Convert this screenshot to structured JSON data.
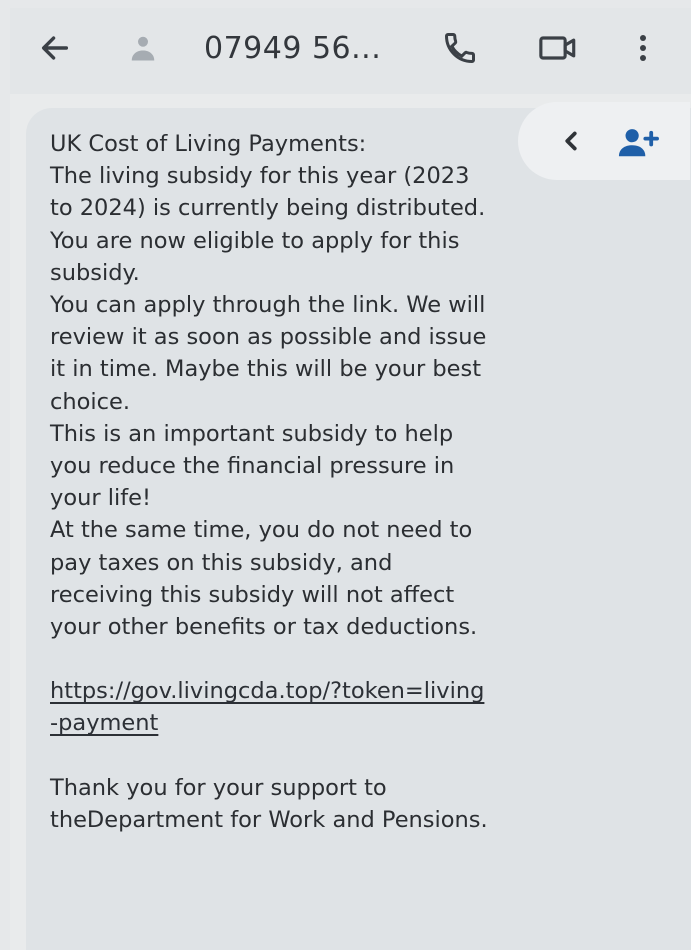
{
  "header": {
    "contact": "07949 56...",
    "icons": [
      "back-arrow-icon",
      "person-icon",
      "phone-icon",
      "video-icon",
      "more-vert-icon"
    ]
  },
  "actions": {
    "icons": [
      "chevron-left-icon",
      "add-contact-icon"
    ]
  },
  "message": {
    "lines": [
      "UK Cost of Living Payments:",
      "The living subsidy for this year (2023",
      "to 2024) is currently being distributed.",
      "You are now eligible to apply for this",
      "subsidy.",
      "You can apply through the link. We will",
      "review it as soon as possible and issue",
      "it in time. Maybe this will be your best",
      "choice.",
      "This is an important subsidy to help",
      "you reduce the financial pressure in",
      "your life!",
      "At the same time, you do not need to",
      "pay taxes on this subsidy, and",
      "receiving this subsidy will not affect",
      "your other benefits or tax deductions."
    ],
    "link_line1": "https://gov.livingcda.top/?token=living",
    "link_line2": "-payment",
    "closing_line1": "Thank you for your support to",
    "closing_line2": "theDepartment for Work and Pensions."
  },
  "colors": {
    "background": "#e9ebec",
    "bubble": "#dfe3e6",
    "text": "#2b2e32",
    "icon": "#3b4046",
    "accent": "#1f5fa8"
  }
}
